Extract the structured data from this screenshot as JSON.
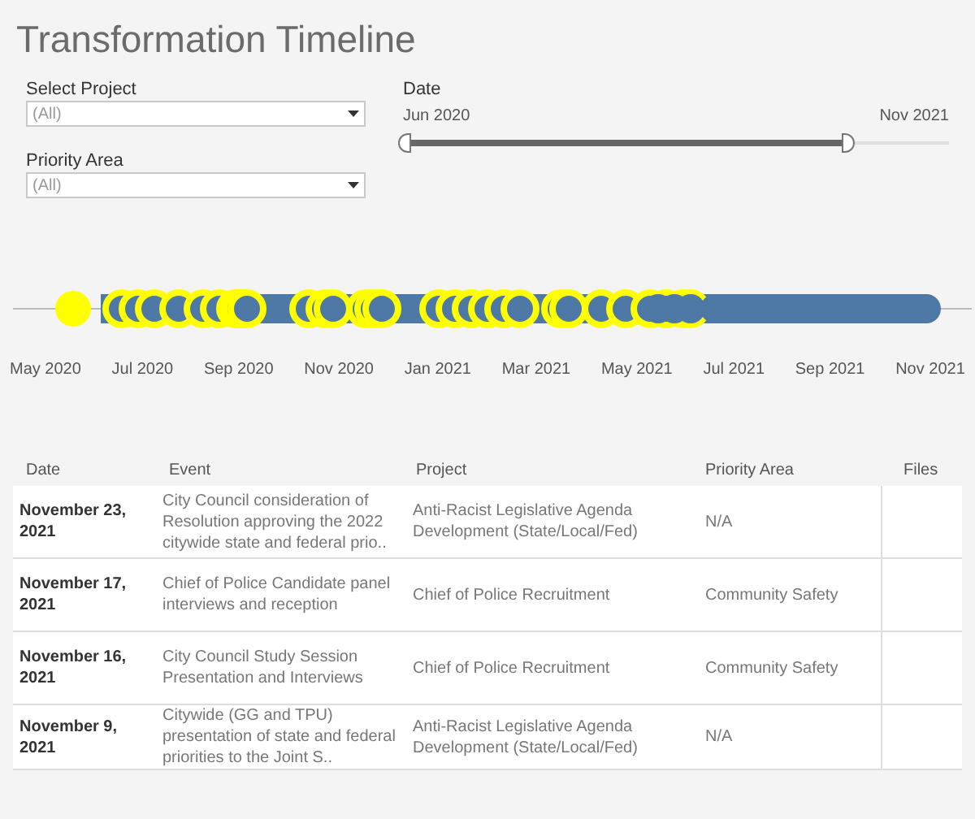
{
  "title": "Transformation Timeline",
  "filters": [
    {
      "label": "Select Project",
      "value": "(All)"
    },
    {
      "label": "Priority Area",
      "value": "(All)"
    }
  ],
  "date_filter": {
    "label": "Date",
    "start": "Jun 2020",
    "end": "Nov 2021",
    "level": 0.81
  },
  "timeline": {
    "axis_labels": [
      "May 2020",
      "Jul 2020",
      "Sep 2020",
      "Nov 2020",
      "Jan 2021",
      "Mar 2021",
      "May 2021",
      "Jul 2021",
      "Sep 2021",
      "Nov 2021"
    ]
  },
  "table": {
    "columns": [
      "Date",
      "Event",
      "Project",
      "Priority Area",
      "Files"
    ],
    "rows": [
      {
        "date": "November 23, 2021",
        "event": "City Council consideration of Resolution approving the 2022 citywide state and federal prio..",
        "project": "Anti-Racist Legislative Agenda Development (State/Local/Fed)",
        "priority_area": "N/A"
      },
      {
        "date": "November 17, 2021",
        "event": "Chief of Police Candidate panel interviews and reception",
        "project": "Chief of Police Recruitment",
        "priority_area": "Community Safety"
      },
      {
        "date": "November 16, 2021",
        "event": "City Council Study Session Presentation and Interviews",
        "project": "Chief of Police Recruitment",
        "priority_area": "Community Safety"
      },
      {
        "date": "November 9, 2021",
        "event": "Citywide (GG and TPU) presentation of state and federal priorities to the Joint S..",
        "project": "Anti-Racist Legislative Agenda Development (State/Local/Fed)",
        "priority_area": "N/A"
      }
    ]
  }
}
